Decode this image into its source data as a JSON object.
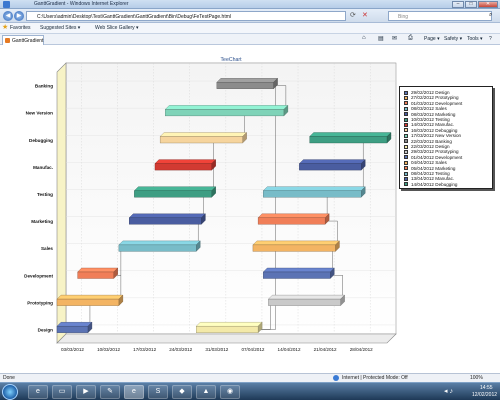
{
  "window": {
    "title": "GanttGradient - Windows Internet Explorer",
    "minimize": "–",
    "maximize": "□",
    "close": "✕"
  },
  "address_bar": {
    "url": "C:\\Users\\admin\\Desktop\\Test\\GanttGradient\\GanttGradient\\Bin\\Debug\\FeTestPage.html",
    "search_placeholder": "Bing",
    "back": "◀",
    "forward": "▶"
  },
  "favorites_bar": {
    "favorites": "Favorites",
    "suggested": "Suggested Sites ▾",
    "slice": "Web Slice Gallery ▾"
  },
  "tab": {
    "label": "GanttGradient"
  },
  "command_bar": {
    "page": "Page ▾",
    "safety": "Safety ▾",
    "tools": "Tools ▾",
    "help": "?"
  },
  "status_bar": {
    "left": "Done",
    "zone": "Internet | Protected Mode: Off",
    "zoom": "100%"
  },
  "taskbar": {
    "time": "14:55",
    "date": "12/02/2012"
  },
  "chart_data": {
    "type": "gantt",
    "title": "TeeChart",
    "categories": [
      "Design",
      "Prototyping",
      "Development",
      "Sales",
      "Marketing",
      "Testing",
      "Manufac.",
      "Debugging",
      "New Version",
      "Banking"
    ],
    "x_ticks": [
      "03/03/2012",
      "10/03/2012",
      "17/03/2012",
      "24/03/2012",
      "31/03/2012",
      "07/04/2012",
      "14/04/2012",
      "21/04/2012",
      "28/04/2012"
    ],
    "xlim": [
      "29/02/2012",
      "03/05/2012"
    ],
    "tasks": [
      {
        "row": "Design",
        "start": "29/02/2012",
        "end": "06/03/2012",
        "color": "#5b73b4"
      },
      {
        "row": "Prototyping",
        "start": "29/02/2012",
        "end": "12/03/2012",
        "color": "#f3b463"
      },
      {
        "row": "Development",
        "start": "04/03/2012",
        "end": "11/03/2012",
        "color": "#f07e58"
      },
      {
        "row": "Sales",
        "start": "12/03/2012",
        "end": "27/03/2012",
        "color": "#78bcc8"
      },
      {
        "row": "Marketing",
        "start": "14/03/2012",
        "end": "28/03/2012",
        "color": "#4a5da0"
      },
      {
        "row": "Testing",
        "start": "15/03/2012",
        "end": "30/03/2012",
        "color": "#3e9e83"
      },
      {
        "row": "Manufac.",
        "start": "19/03/2012",
        "end": "30/03/2012",
        "color": "#d23a32"
      },
      {
        "row": "Debugging",
        "start": "20/03/2012",
        "end": "05/04/2012",
        "color": "#f6d49d"
      },
      {
        "row": "New Version",
        "start": "21/03/2012",
        "end": "13/04/2012",
        "color": "#7fd3b8"
      },
      {
        "row": "Banking",
        "start": "31/03/2012",
        "end": "11/04/2012",
        "color": "#8c8c8c"
      },
      {
        "row": "Design",
        "start": "27/03/2012",
        "end": "08/04/2012",
        "color": "#f3e9a8"
      },
      {
        "row": "Prototyping",
        "start": "10/04/2012",
        "end": "24/04/2012",
        "color": "#c9c9c9"
      },
      {
        "row": "Development",
        "start": "09/04/2012",
        "end": "22/04/2012",
        "color": "#5b73b4"
      },
      {
        "row": "Sales",
        "start": "07/04/2012",
        "end": "23/04/2012",
        "color": "#f3b463"
      },
      {
        "row": "Marketing",
        "start": "08/04/2012",
        "end": "21/04/2012",
        "color": "#f07e58"
      },
      {
        "row": "Testing",
        "start": "09/04/2012",
        "end": "28/04/2012",
        "color": "#78bcc8"
      },
      {
        "row": "Manufac.",
        "start": "16/04/2012",
        "end": "28/04/2012",
        "color": "#4a5da0"
      },
      {
        "row": "Debugging",
        "start": "18/04/2012",
        "end": "03/05/2012",
        "color": "#3e9e83"
      }
    ],
    "legend": [
      {
        "label": "29/02/2012 Design",
        "color": "#5b73b4"
      },
      {
        "label": "27/02/2012 Prototyping",
        "color": "#f3b463"
      },
      {
        "label": "01/03/2012 Development",
        "color": "#f07e58"
      },
      {
        "label": "08/03/2012 Sales",
        "color": "#78bcc8"
      },
      {
        "label": "08/03/2012 Marketing",
        "color": "#4a5da0"
      },
      {
        "label": "10/03/2012 Testing",
        "color": "#3e9e83"
      },
      {
        "label": "14/03/2012 Manufac.",
        "color": "#d23a32"
      },
      {
        "label": "16/03/2012 Debugging",
        "color": "#f6d49d"
      },
      {
        "label": "17/03/2012 New Version",
        "color": "#7fd3b8"
      },
      {
        "label": "22/03/2012 Banking",
        "color": "#8c8c8c"
      },
      {
        "label": "22/03/2012 Design",
        "color": "#f3e9a8"
      },
      {
        "label": "29/03/2012 Prototyping",
        "color": "#c9c9c9"
      },
      {
        "label": "01/04/2012 Development",
        "color": "#5b73b4"
      },
      {
        "label": "04/04/2012 Sales",
        "color": "#f3b463"
      },
      {
        "label": "05/04/2012 Marketing",
        "color": "#f07e58"
      },
      {
        "label": "08/04/2012 Testing",
        "color": "#78bcc8"
      },
      {
        "label": "13/04/2012 Manufac.",
        "color": "#4a5da0"
      },
      {
        "label": "14/04/2012 Debugging",
        "color": "#3e9e83"
      }
    ]
  }
}
